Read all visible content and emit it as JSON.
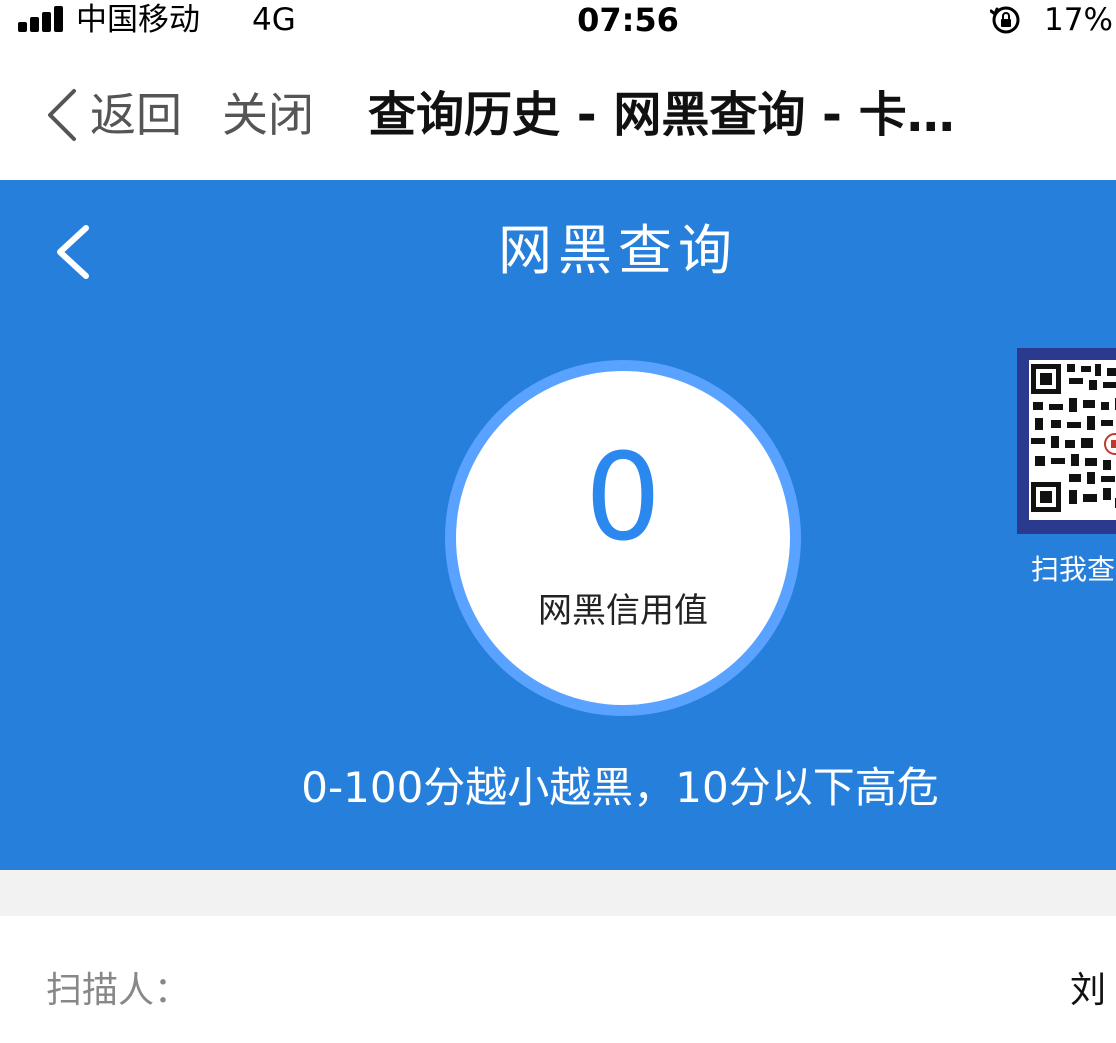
{
  "status_bar": {
    "carrier": "中国移动",
    "network": "4G",
    "time": "07:56",
    "battery": "17%",
    "icons": [
      "signal-icon",
      "orientation-lock-icon"
    ]
  },
  "nav": {
    "back_label": "返回",
    "close_label": "关闭",
    "title": "查询历史 - 网黑查询 - 卡…",
    "icons": [
      "chevron-left-icon"
    ]
  },
  "hero": {
    "title": "网黑查询",
    "score": "0",
    "score_label": "网黑信用值",
    "qr_caption": "扫我查",
    "hint": "0-100分越小越黑，10分以下高危",
    "icons": [
      "back-arrow-icon",
      "qr-code"
    ],
    "colors": {
      "background": "#267fdb",
      "ring": "#5aa2ff",
      "score": "#2a88ef"
    }
  },
  "info": {
    "rows": [
      {
        "label": "扫描人：",
        "value": "刘"
      }
    ]
  }
}
